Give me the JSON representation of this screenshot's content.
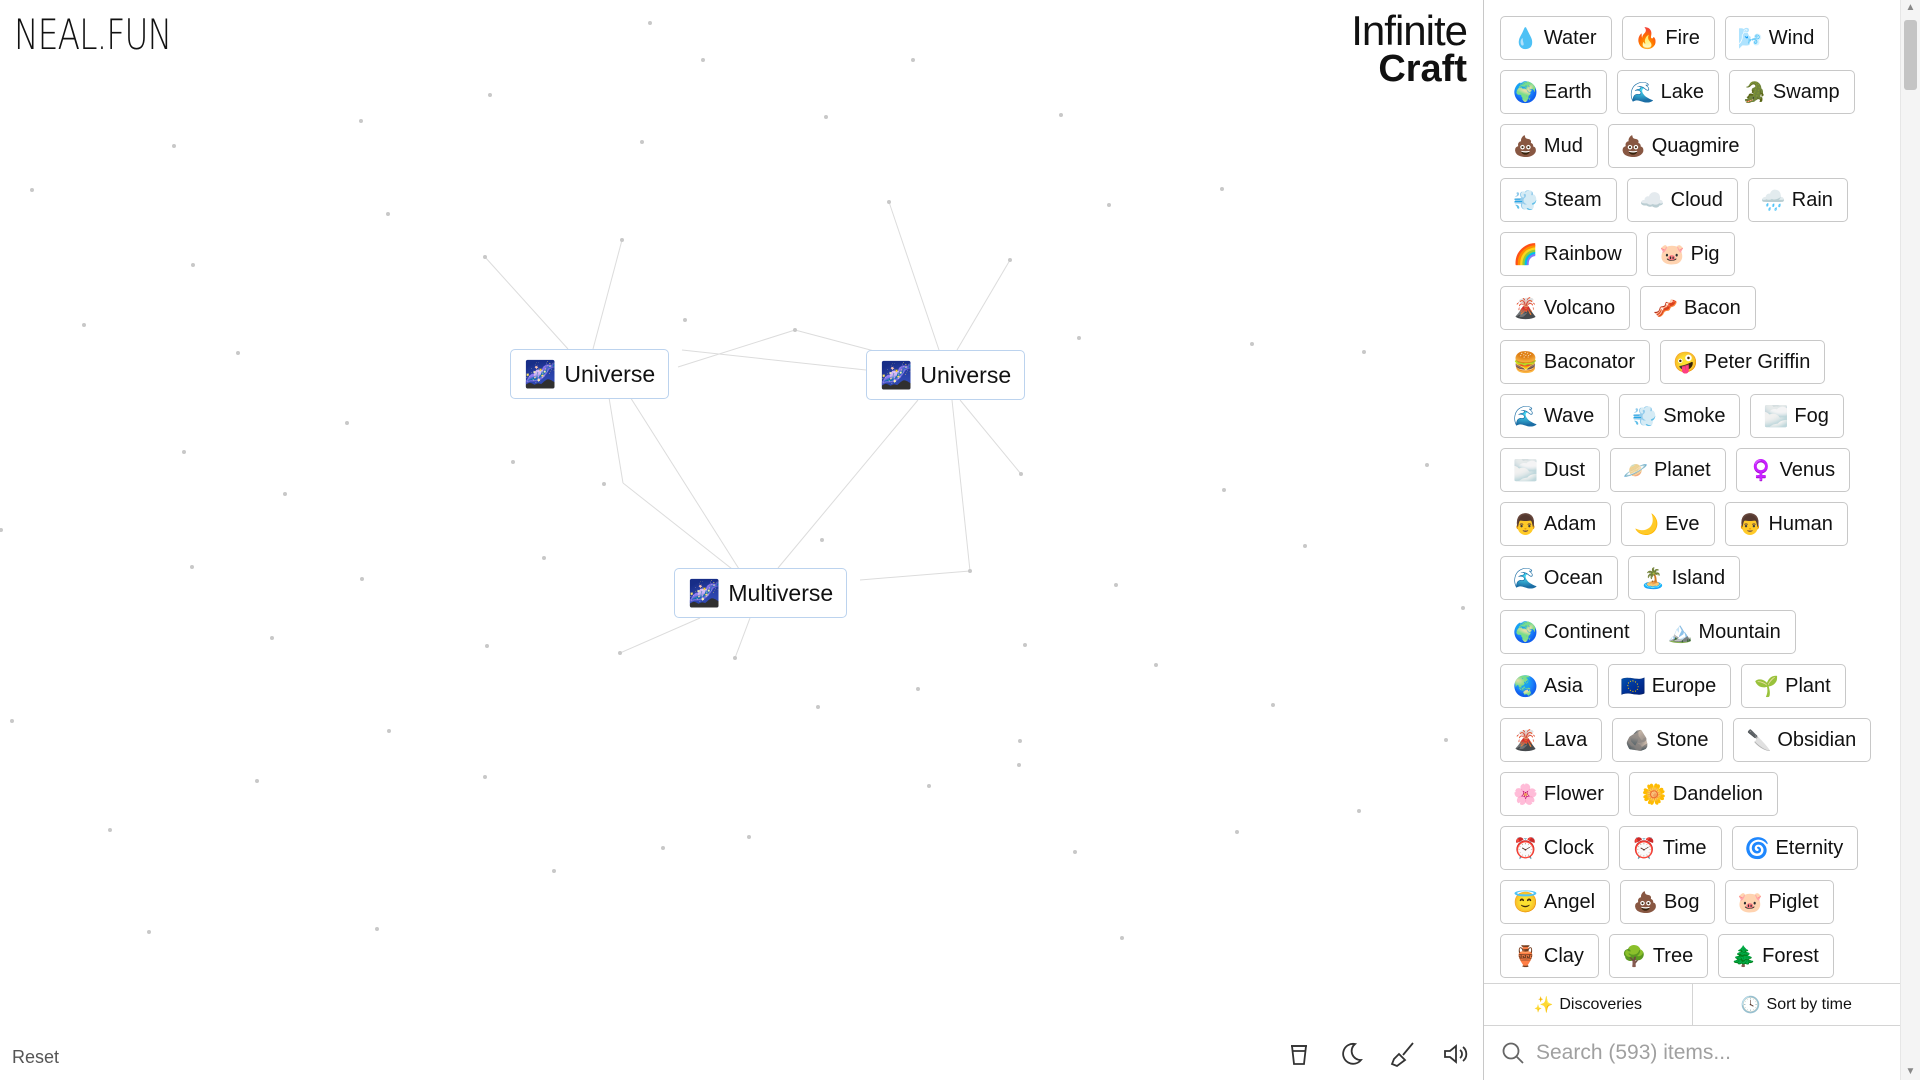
{
  "logo": {
    "neal": "NEAL.FUN",
    "infinite_line1": "Infinite",
    "infinite_line2": "Craft"
  },
  "canvas": {
    "instances": [
      {
        "emoji": "🌌",
        "label": "Universe"
      },
      {
        "emoji": "🌌",
        "label": "Universe"
      },
      {
        "emoji": "🌌",
        "label": "Multiverse"
      }
    ],
    "reset_label": "Reset",
    "tools": [
      "coffee-icon",
      "moon-icon",
      "broom-icon",
      "sound-icon"
    ]
  },
  "sidebar": {
    "rows": [
      [
        {
          "emoji": "💧",
          "label": "Water"
        },
        {
          "emoji": "🔥",
          "label": "Fire"
        },
        {
          "emoji": "🌬️",
          "label": "Wind"
        }
      ],
      [
        {
          "emoji": "🌍",
          "label": "Earth"
        },
        {
          "emoji": "🌊",
          "label": "Lake"
        },
        {
          "emoji": "🐊",
          "label": "Swamp"
        }
      ],
      [
        {
          "emoji": "💩",
          "label": "Mud"
        },
        {
          "emoji": "💩",
          "label": "Quagmire"
        }
      ],
      [
        {
          "emoji": "💨",
          "label": "Steam"
        },
        {
          "emoji": "☁️",
          "label": "Cloud"
        },
        {
          "emoji": "🌧️",
          "label": "Rain"
        }
      ],
      [
        {
          "emoji": "🌈",
          "label": "Rainbow"
        },
        {
          "emoji": "🐷",
          "label": "Pig"
        }
      ],
      [
        {
          "emoji": "🌋",
          "label": "Volcano"
        },
        {
          "emoji": "🥓",
          "label": "Bacon"
        }
      ],
      [
        {
          "emoji": "🍔",
          "label": "Baconator"
        },
        {
          "emoji": "🤪",
          "label": "Peter Griffin"
        }
      ],
      [
        {
          "emoji": "🌊",
          "label": "Wave"
        },
        {
          "emoji": "💨",
          "label": "Smoke"
        },
        {
          "emoji": "🌫️",
          "label": "Fog"
        }
      ],
      [
        {
          "emoji": "🌫️",
          "label": "Dust"
        },
        {
          "emoji": "🪐",
          "label": "Planet"
        },
        {
          "emoji": "♀️",
          "label": "Venus"
        }
      ],
      [
        {
          "emoji": "👨",
          "label": "Adam"
        },
        {
          "emoji": "🌙",
          "label": "Eve"
        },
        {
          "emoji": "👨",
          "label": "Human"
        }
      ],
      [
        {
          "emoji": "🌊",
          "label": "Ocean"
        },
        {
          "emoji": "🏝️",
          "label": "Island"
        }
      ],
      [
        {
          "emoji": "🌍",
          "label": "Continent"
        },
        {
          "emoji": "🏔️",
          "label": "Mountain"
        }
      ],
      [
        {
          "emoji": "🌏",
          "label": "Asia"
        },
        {
          "emoji": "🇪🇺",
          "label": "Europe"
        },
        {
          "emoji": "🌱",
          "label": "Plant"
        }
      ],
      [
        {
          "emoji": "🌋",
          "label": "Lava"
        },
        {
          "emoji": "🪨",
          "label": "Stone"
        },
        {
          "emoji": "🔪",
          "label": "Obsidian"
        }
      ],
      [
        {
          "emoji": "🌸",
          "label": "Flower"
        },
        {
          "emoji": "🌼",
          "label": "Dandelion"
        }
      ],
      [
        {
          "emoji": "⏰",
          "label": "Clock"
        },
        {
          "emoji": "⏰",
          "label": "Time"
        },
        {
          "emoji": "🌀",
          "label": "Eternity"
        }
      ],
      [
        {
          "emoji": "😇",
          "label": "Angel"
        },
        {
          "emoji": "💩",
          "label": "Bog"
        },
        {
          "emoji": "🐷",
          "label": "Piglet"
        }
      ],
      [
        {
          "emoji": "🏺",
          "label": "Clay"
        },
        {
          "emoji": "🌳",
          "label": "Tree"
        },
        {
          "emoji": "🌲",
          "label": "Forest"
        }
      ]
    ],
    "discoveries_label": "Discoveries",
    "sort_label": "Sort by time",
    "search_placeholder": "Search (593) items..."
  }
}
